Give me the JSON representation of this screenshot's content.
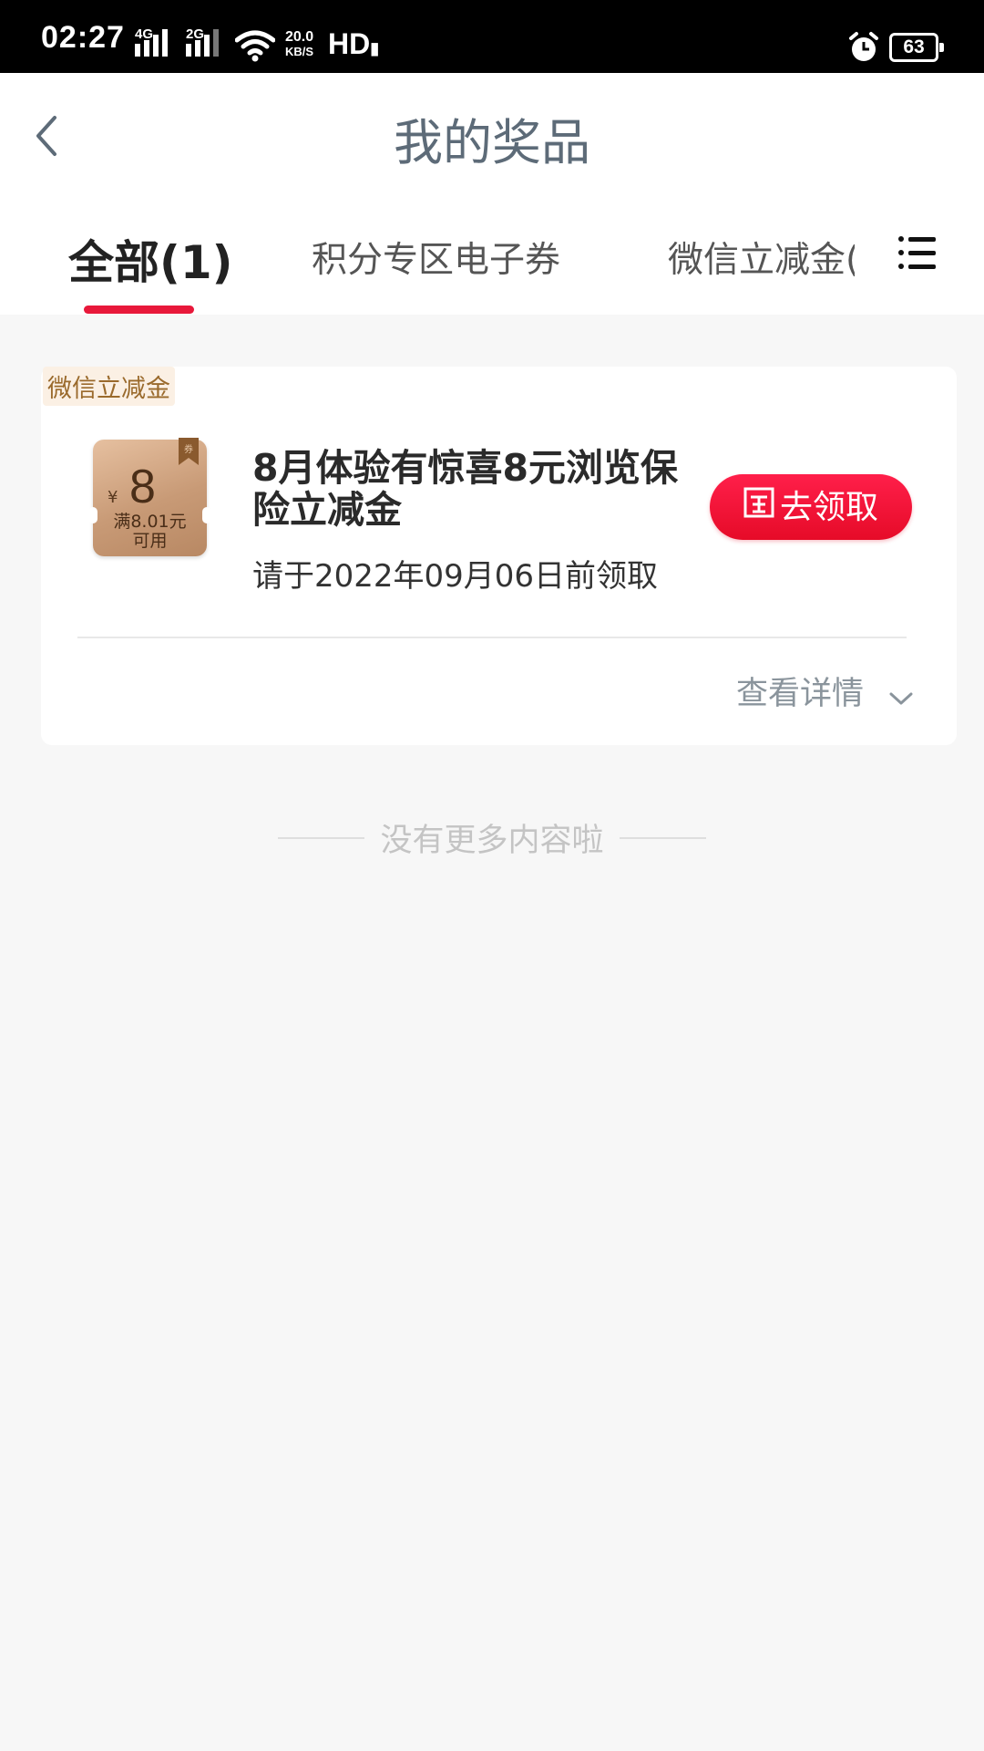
{
  "status_bar": {
    "time": "02:27",
    "net1": "4G",
    "net2": "2G",
    "speed_value": "20.0",
    "speed_unit": "KB/S",
    "hd": "HD",
    "battery": "63"
  },
  "header": {
    "title": "我的奖品"
  },
  "tabs": [
    {
      "label": "全部(1)"
    },
    {
      "label": "积分专区电子券"
    },
    {
      "label": "微信立减金("
    }
  ],
  "prize_card": {
    "tag": "微信立减金",
    "coupon": {
      "currency": "¥",
      "amount": "8",
      "condition_line1": "满8.01元",
      "condition_line2": "可用"
    },
    "title": "8月体验有惊喜8元浏览保险立减金",
    "deadline": "请于2022年09月06日前领取",
    "claim_label": "去领取",
    "detail_label": "查看详情"
  },
  "end_hint": "没有更多内容啦",
  "colors": {
    "accent": "#e8183a",
    "title_gray": "#5d6b78",
    "tag_bg": "#fbf0e4",
    "tag_text": "#9a6a2c"
  }
}
